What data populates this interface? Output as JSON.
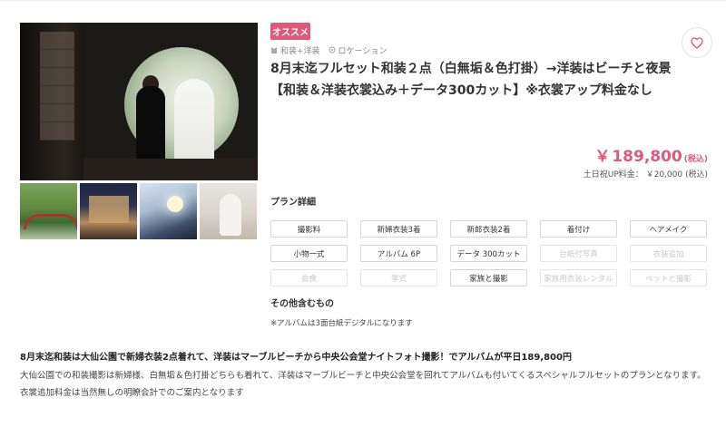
{
  "badge": "オススメ",
  "tags": [
    {
      "label": "和装+洋装",
      "icon": "kimono-icon"
    },
    {
      "label": "ロケーション",
      "icon": "location-icon"
    }
  ],
  "title": "8月末迄フルセット和装２点（白無垢＆色打掛）→洋装はビーチと夜景【和装＆洋装衣裳込み＋データ300カット】※衣裳アップ料金なし",
  "price": {
    "currency": "￥",
    "amount": "189,800",
    "tax": "(税込)"
  },
  "weekend_fee": "土日祝UP料金： ￥20,000 (税込)",
  "plan_details_title": "プラン詳細",
  "plan_items": [
    {
      "label": "撮影料",
      "included": true
    },
    {
      "label": "新婦衣装3着",
      "included": true
    },
    {
      "label": "新郎衣装2着",
      "included": true
    },
    {
      "label": "着付け",
      "included": true
    },
    {
      "label": "ヘアメイク",
      "included": true
    },
    {
      "label": "小物一式",
      "included": true
    },
    {
      "label": "アルバム 6P",
      "included": true
    },
    {
      "label": "データ 300カット",
      "included": true
    },
    {
      "label": "台紙付写真",
      "included": false
    },
    {
      "label": "衣装追加",
      "included": false
    },
    {
      "label": "会食",
      "included": false
    },
    {
      "label": "挙式",
      "included": false
    },
    {
      "label": "家族と撮影",
      "included": true
    },
    {
      "label": "家族用衣装レンタル",
      "included": false
    },
    {
      "label": "ペットと撮影",
      "included": false
    }
  ],
  "other_title": "その他含むもの",
  "other_note": "※アルバムは3面台紙デジタルになります",
  "description_title": "8月末迄和装は大仙公園で新婦衣装2点着れて、洋装はマーブルビーチから中央公会堂ナイトフォト撮影！でアルバムが平日189,800円",
  "description_body": "大仙公園での和装撮影は新婦様、白無垢＆色打掛どちらも着れて、洋装はマーブルビーチと中央公会堂を回れてアルバムも付いてくるスペシャルフルセットのプランとなります。衣裳追加料金は当然無しの明瞭会計でのご案内となります",
  "colors": {
    "accent": "#e0587a",
    "disabled_text": "#c8c8c8",
    "border": "#d6d6d6"
  }
}
